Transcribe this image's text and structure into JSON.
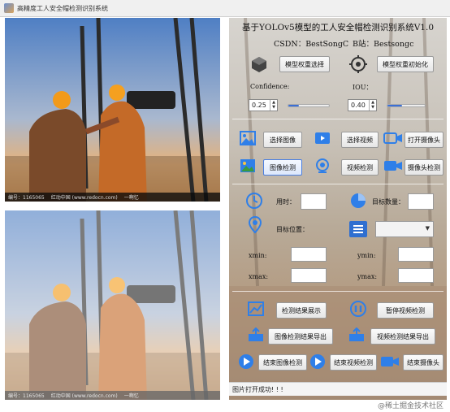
{
  "window": {
    "title": "高精度工人安全帽检测识别系统"
  },
  "images": {
    "top_caption": [
      "编号：1165065",
      "红动中国 (www.redocn.com)",
      "一啊忆"
    ],
    "bottom_caption": [
      "编号：1165065",
      "红动中国 (www.redocn.com)",
      "一啊忆"
    ]
  },
  "header": {
    "title": "基于YOLOv5模型的工人安全帽检测识别系统V1.0",
    "csdn": "CSDN：BestSongC",
    "bilibili": "B站：Bestsongc"
  },
  "model": {
    "select_label": "模型权重选择",
    "init_label": "模型权重初始化"
  },
  "params": {
    "confidence_label": "Confidence:",
    "iou_label": "IOU：",
    "confidence_value": "0.25",
    "iou_value": "0.40",
    "confidence_fraction": 0.25,
    "iou_fraction": 0.4
  },
  "actions": {
    "select_image": "选择图像",
    "select_video": "选择视频",
    "open_camera": "打开摄像头",
    "image_detect": "图像检测",
    "video_detect": "视频检测",
    "camera_detect": "摄像头检测"
  },
  "results": {
    "time_label": "用时：",
    "count_label": "目标数量：",
    "position_label": "目标位置：",
    "xmin": "xmin:",
    "ymin": "ymin:",
    "xmax": "xmax:",
    "ymax": "ymax:"
  },
  "bottom_actions": {
    "show_results": "检测结果展示",
    "pause_video": "暂停视频检测",
    "export_image": "图像检测结果导出",
    "export_video": "视频检测结果导出",
    "end_image": "结束图像检测",
    "end_video": "结束视频检测",
    "end_camera": "结束摄像头"
  },
  "status": {
    "message": "图片打开成功! ! !",
    "watermark": "@稀土掘金技术社区"
  },
  "colors": {
    "accent": "#3b6fd6",
    "icon_blue": "#2f7fe8"
  }
}
